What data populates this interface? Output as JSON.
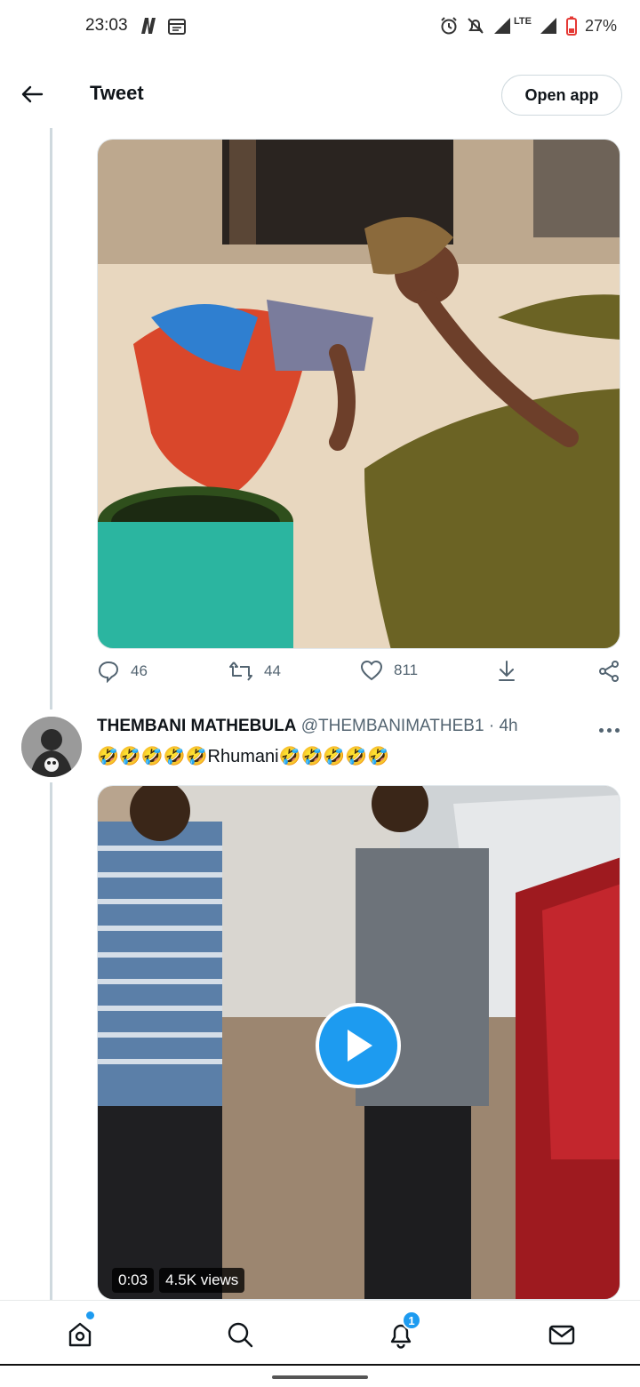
{
  "status_bar": {
    "time": "23:03",
    "network": "LTE",
    "battery": "27%"
  },
  "header": {
    "title": "Tweet",
    "open_app": "Open app"
  },
  "tweet1": {
    "replies": "46",
    "retweets": "44",
    "likes": "811"
  },
  "tweet2": {
    "author_name": "THEMBANI MATHEBULA",
    "handle": "@THEMBANIMATHEB1",
    "separator": "·",
    "time": "4h",
    "text": "🤣🤣🤣🤣🤣Rhumani🤣🤣🤣🤣🤣",
    "video": {
      "duration": "0:03",
      "views": "4.5K views"
    }
  },
  "nav": {
    "notifications_badge": "1"
  },
  "colors": {
    "accent": "#1d9bf0",
    "text_secondary": "#536471",
    "border": "#cfd9de"
  }
}
